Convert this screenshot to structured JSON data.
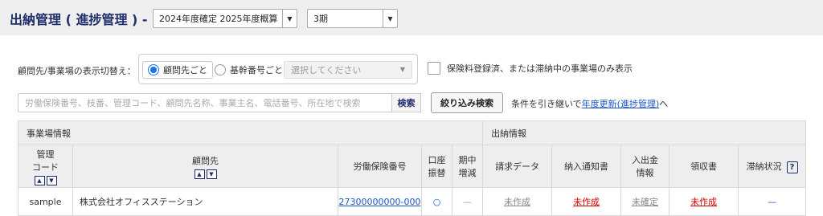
{
  "header": {
    "title": "出納管理 ( 進捗管理 ) -",
    "year_select": "2024年度確定 2025年度概算",
    "period_select": "3期"
  },
  "view_toggle": {
    "label": "顧問先/事業場の表示切替え：",
    "option_client": "顧問先ごと",
    "option_base": "基幹番号ごと",
    "sub_select_placeholder": "選択してください",
    "selected": "顧問先ごと"
  },
  "filter_checkbox": {
    "label": "保険料登録済、または滞納中の事業場のみ表示",
    "checked": false
  },
  "search": {
    "placeholder": "労働保険番号、枝番、管理コード、顧問先名称、事業主名、電話番号、所在地で検索",
    "button": "検索",
    "narrow_button": "絞り込み検索"
  },
  "hint": {
    "prefix": "条件を引き継いで",
    "link": "年度更新(進捗管理)",
    "suffix": "へ"
  },
  "table": {
    "group_site": "事業場情報",
    "group_cash": "出納情報",
    "col_code_1": "管理",
    "col_code_2": "コード",
    "col_client": "顧問先",
    "col_insurance_no": "労働保険番号",
    "col_debit_1": "口座",
    "col_debit_2": "振替",
    "col_midterm_1": "期中",
    "col_midterm_2": "増減",
    "col_invoice": "請求データ",
    "col_notice": "納入通知書",
    "col_payment_1": "入出金",
    "col_payment_2": "情報",
    "col_receipt": "領収書",
    "col_arrears": "滞納状況",
    "help_icon": "?",
    "rows": [
      {
        "code": "sample",
        "client": "株式会社オフィスステーション",
        "insurance_no": "27300000000-000",
        "debit": "○",
        "midterm": "—",
        "invoice": "未作成",
        "notice": "未作成",
        "payment": "未確定",
        "receipt": "未作成",
        "arrears": "—"
      }
    ]
  },
  "colors": {
    "title": "#1f2d6b",
    "link": "#1a56c8",
    "alert": "#e00000"
  }
}
